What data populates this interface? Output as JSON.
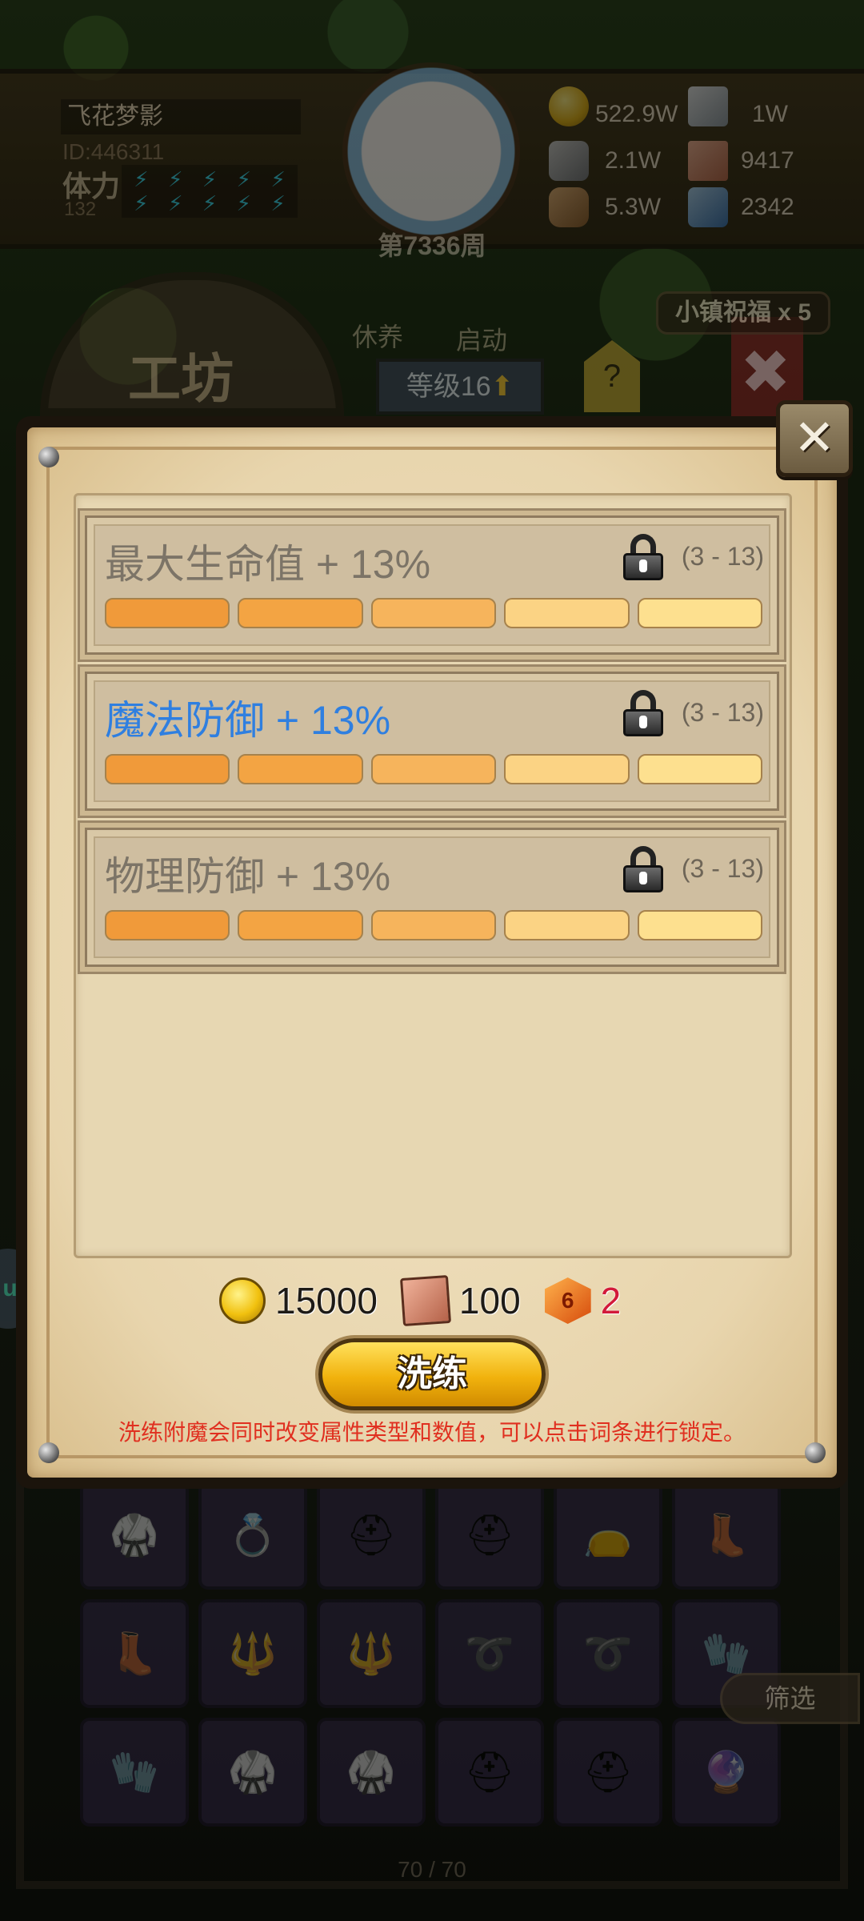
{
  "player": {
    "name": "飞花梦影",
    "id": "ID:446311",
    "stamina_label": "体力",
    "stamina_value": "132"
  },
  "week": "第7336周",
  "resources": [
    {
      "icon": "gold-coin-icon",
      "value": "522.9W"
    },
    {
      "icon": "crystal-icon",
      "value": "1W"
    },
    {
      "icon": "ore-icon",
      "value": "2.1W"
    },
    {
      "icon": "scroll-icon",
      "value": "9417"
    },
    {
      "icon": "wood-icon",
      "value": "5.3W"
    },
    {
      "icon": "blue-gem-icon",
      "value": "2342"
    }
  ],
  "background": {
    "menu_rest": "休养",
    "menu_start": "启动",
    "workshop_title": "工坊",
    "level_tab": "等级16",
    "help_tab": "?",
    "town_blessing": "小镇祝福 x 5",
    "side_pill": "up",
    "filter": "筛选",
    "inventory_count": "70 / 70"
  },
  "affixes": [
    {
      "text": "最大生命值 + 13%",
      "range": "(3 - 13)",
      "active": false,
      "fill": 3
    },
    {
      "text": "魔法防御 + 13%",
      "range": "(3 - 13)",
      "active": true,
      "fill": 3
    },
    {
      "text": "物理防御 + 13%",
      "range": "(3 - 13)",
      "active": false,
      "fill": 3
    }
  ],
  "bar_colors": [
    "#f09a3a",
    "#f3a443",
    "#f6b45c",
    "#fbd384",
    "#fde08f"
  ],
  "costs": {
    "gold": "15000",
    "scroll": "100",
    "gem": "2",
    "gem_digit": "6"
  },
  "refine_button": "洗练",
  "hint": "洗练附魔会同时改变属性类型和数值，可以点击词条进行锁定。"
}
